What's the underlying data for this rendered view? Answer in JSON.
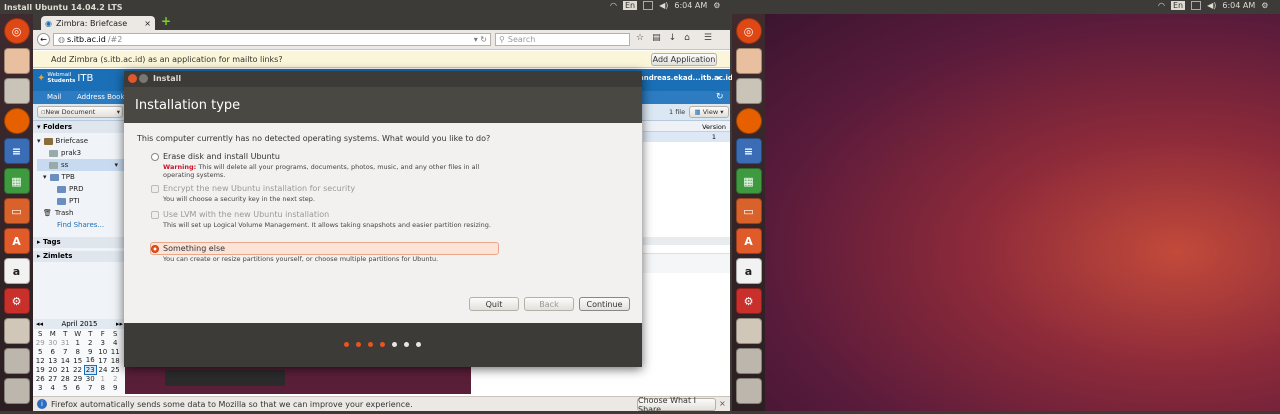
{
  "topbar": {
    "title": "Install Ubuntu 14.04.2 LTS",
    "lang": "En",
    "time": "6:04 AM",
    "lang2": "En",
    "time2": "6:04 AM"
  },
  "firefox": {
    "tab_title": "Zimbra: Briefcase",
    "new_tab": "+",
    "url_host": "s.itb.ac.id",
    "url_path": "/#2",
    "search_placeholder": "Search",
    "notification": "Add Zimbra (s.itb.ac.id) as an application for mailto links?",
    "add_app": "Add Application",
    "bottom_notice": "Firefox automatically sends some data to Mozilla so that we can improve your experience.",
    "choose_share": "Choose What I Share"
  },
  "zimbra": {
    "logo_top": "Webmail",
    "logo_mid": "Students",
    "logo_brand": "ITB",
    "user": "andreas.ekad...itb.ac.id",
    "tabs": [
      "Mail",
      "Address Book"
    ],
    "new_doc": "New Document",
    "folders_header": "Folders",
    "tree": [
      "Briefcase",
      "prak3",
      "ss",
      "TPB",
      "PRD",
      "PTI",
      "Trash"
    ],
    "find_shares": "Find Shares...",
    "tags": "Tags",
    "zimlets": "Zimlets",
    "file_count": "1 file",
    "view": "View",
    "version_header": "Version",
    "version_value": "1",
    "calendar": {
      "month": "April 2015",
      "days": [
        "S",
        "M",
        "T",
        "W",
        "T",
        "F",
        "S"
      ],
      "weeks": [
        [
          "29",
          "30",
          "31",
          "1",
          "2",
          "3",
          "4"
        ],
        [
          "5",
          "6",
          "7",
          "8",
          "9",
          "10",
          "11"
        ],
        [
          "12",
          "13",
          "14",
          "15",
          "16",
          "17",
          "18"
        ],
        [
          "19",
          "20",
          "21",
          "22",
          "23",
          "24",
          "25"
        ],
        [
          "26",
          "27",
          "28",
          "29",
          "30",
          "1",
          "2"
        ],
        [
          "3",
          "4",
          "5",
          "6",
          "7",
          "8",
          "9"
        ]
      ]
    }
  },
  "installer": {
    "window_title": "Install",
    "heading": "Installation type",
    "question": "This computer currently has no detected operating systems. What would you like to do?",
    "options": [
      {
        "label": "Erase disk and install Ubuntu",
        "warn": "Warning:",
        "desc": " This will delete all your programs, documents, photos, music, and any other files in all operating systems."
      },
      {
        "label": "Encrypt the new Ubuntu installation for security",
        "desc": "You will choose a security key in the next step."
      },
      {
        "label": "Use LVM with the new Ubuntu installation",
        "desc": "This will set up Logical Volume Management. It allows taking snapshots and easier partition resizing."
      },
      {
        "label": "Something else",
        "desc": "You can create or resize partitions yourself, or choose multiple partitions for Ubuntu."
      }
    ],
    "buttons": {
      "quit": "Quit",
      "back": "Back",
      "continue": "Continue"
    },
    "progress": {
      "steps_done": 4,
      "steps_total": 7
    }
  },
  "colors": {
    "accent": "#e95420",
    "launcher_bg": "#2b1f22",
    "zimbra_blue": "#1a6fb6"
  }
}
